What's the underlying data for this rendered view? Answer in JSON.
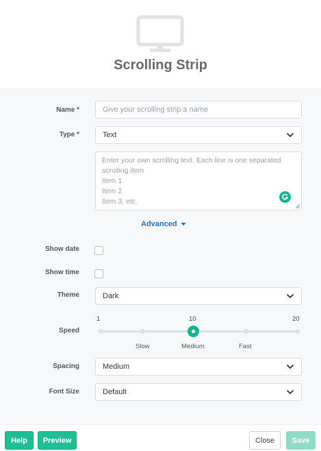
{
  "header": {
    "icon": "monitor-icon",
    "title": "Scrolling Strip"
  },
  "form": {
    "name": {
      "label": "Name *",
      "placeholder": "Give your scrolling strip a name",
      "value": ""
    },
    "type": {
      "label": "Type *",
      "value": "Text"
    },
    "text_content": {
      "placeholder": "Enter your own scrolling text. Each line is one separated scrolling item\nItem 1\nItem 2\nItem 3, etc."
    },
    "advanced_label": "Advanced",
    "show_date": {
      "label": "Show date",
      "checked": false
    },
    "show_time": {
      "label": "Show time",
      "checked": false
    },
    "theme": {
      "label": "Theme",
      "value": "Dark"
    },
    "speed": {
      "label": "Speed",
      "min_label": "1",
      "mid_label": "10",
      "max_label": "20",
      "value": 10,
      "slow_label": "Slow",
      "medium_label": "Medium",
      "fast_label": "Fast"
    },
    "spacing": {
      "label": "Spacing",
      "value": "Medium"
    },
    "font_size": {
      "label": "Font Size",
      "value": "Default"
    }
  },
  "footer": {
    "help_label": "Help",
    "preview_label": "Preview",
    "close_label": "Close",
    "save_label": "Save"
  },
  "colors": {
    "accent": "#1fbf95",
    "link": "#2a6fb4",
    "save_disabled": "#8fdcc6"
  }
}
